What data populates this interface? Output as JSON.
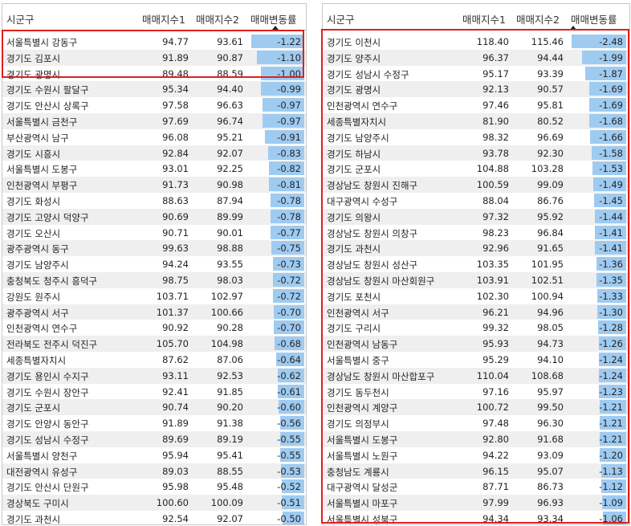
{
  "headers": {
    "name": "시군구",
    "idx1": "매매지수1",
    "idx2": "매매지수2",
    "chg": "매매변동률"
  },
  "colors": {
    "bar": "#9fcbf1",
    "highlight": "#e0201c",
    "alt_row": "#efefef"
  },
  "chart_data": [
    {
      "type": "table",
      "columns": [
        "시군구",
        "매매지수1",
        "매매지수2",
        "매매변동률"
      ],
      "sort": "매매변동률 ascending",
      "rows": [
        [
          "서울특별시 강동구",
          "94.77",
          "93.61",
          "-1.22"
        ],
        [
          "경기도 김포시",
          "91.89",
          "90.87",
          "-1.10"
        ],
        [
          "경기도 광명시",
          "89.48",
          "88.59",
          "-1.00"
        ],
        [
          "경기도 수원시 팔달구",
          "95.34",
          "94.40",
          "-0.99"
        ],
        [
          "경기도 안산시 상록구",
          "97.58",
          "96.63",
          "-0.97"
        ],
        [
          "서울특별시 금천구",
          "97.69",
          "96.74",
          "-0.97"
        ],
        [
          "부산광역시 남구",
          "96.08",
          "95.21",
          "-0.91"
        ],
        [
          "경기도 시흥시",
          "92.84",
          "92.07",
          "-0.83"
        ],
        [
          "서울특별시 도봉구",
          "93.01",
          "92.25",
          "-0.82"
        ],
        [
          "인천광역시 부평구",
          "91.73",
          "90.98",
          "-0.81"
        ],
        [
          "경기도 화성시",
          "88.63",
          "87.94",
          "-0.78"
        ],
        [
          "경기도 고양시 덕양구",
          "90.69",
          "89.99",
          "-0.78"
        ],
        [
          "경기도 오산시",
          "90.71",
          "90.01",
          "-0.77"
        ],
        [
          "광주광역시 동구",
          "99.63",
          "98.88",
          "-0.75"
        ],
        [
          "경기도 남양주시",
          "94.24",
          "93.55",
          "-0.73"
        ],
        [
          "충청북도 청주시 흥덕구",
          "98.75",
          "98.03",
          "-0.72"
        ],
        [
          "강원도 원주시",
          "103.71",
          "102.97",
          "-0.72"
        ],
        [
          "광주광역시 서구",
          "101.37",
          "100.66",
          "-0.70"
        ],
        [
          "인천광역시 연수구",
          "90.92",
          "90.28",
          "-0.70"
        ],
        [
          "전라북도 전주시 덕진구",
          "105.70",
          "104.98",
          "-0.68"
        ],
        [
          "세종특별자치시",
          "87.62",
          "87.06",
          "-0.64"
        ],
        [
          "경기도 용인시 수지구",
          "93.11",
          "92.53",
          "-0.62"
        ],
        [
          "경기도 수원시 장안구",
          "92.41",
          "91.85",
          "-0.61"
        ],
        [
          "경기도 군포시",
          "90.74",
          "90.20",
          "-0.60"
        ],
        [
          "경기도 안양시 동안구",
          "91.89",
          "91.38",
          "-0.56"
        ],
        [
          "경기도 성남시 수정구",
          "89.69",
          "89.19",
          "-0.55"
        ],
        [
          "서울특별시 양천구",
          "95.94",
          "95.41",
          "-0.55"
        ],
        [
          "대전광역시 유성구",
          "89.03",
          "88.55",
          "-0.53"
        ],
        [
          "경기도 안산시 단원구",
          "95.98",
          "95.48",
          "-0.52"
        ],
        [
          "경상북도 구미시",
          "100.60",
          "100.09",
          "-0.51"
        ],
        [
          "경기도 과천시",
          "92.54",
          "92.07",
          "-0.50"
        ]
      ]
    },
    {
      "type": "table",
      "columns": [
        "시군구",
        "매매지수1",
        "매매지수2",
        "매매변동률"
      ],
      "sort": "매매변동률 ascending",
      "rows": [
        [
          "경기도 이천시",
          "118.40",
          "115.46",
          "-2.48"
        ],
        [
          "경기도 양주시",
          "96.37",
          "94.44",
          "-1.99"
        ],
        [
          "경기도 성남시 수정구",
          "95.17",
          "93.39",
          "-1.87"
        ],
        [
          "경기도 광명시",
          "92.13",
          "90.57",
          "-1.69"
        ],
        [
          "인천광역시 연수구",
          "97.46",
          "95.81",
          "-1.69"
        ],
        [
          "세종특별자치시",
          "81.90",
          "80.52",
          "-1.68"
        ],
        [
          "경기도 남양주시",
          "98.32",
          "96.69",
          "-1.66"
        ],
        [
          "경기도 하남시",
          "93.78",
          "92.30",
          "-1.58"
        ],
        [
          "경기도 군포시",
          "104.88",
          "103.28",
          "-1.53"
        ],
        [
          "경상남도 창원시 진해구",
          "100.59",
          "99.09",
          "-1.49"
        ],
        [
          "대구광역시 수성구",
          "88.04",
          "86.76",
          "-1.45"
        ],
        [
          "경기도 의왕시",
          "97.32",
          "95.92",
          "-1.44"
        ],
        [
          "경상남도 창원시 의창구",
          "98.23",
          "96.84",
          "-1.41"
        ],
        [
          "경기도 과천시",
          "92.96",
          "91.65",
          "-1.41"
        ],
        [
          "경상남도 창원시 성산구",
          "103.35",
          "101.95",
          "-1.36"
        ],
        [
          "경상남도 창원시 마산회원구",
          "103.91",
          "102.51",
          "-1.35"
        ],
        [
          "경기도 포천시",
          "102.30",
          "100.94",
          "-1.33"
        ],
        [
          "인천광역시 서구",
          "96.21",
          "94.96",
          "-1.30"
        ],
        [
          "경기도 구리시",
          "99.32",
          "98.05",
          "-1.28"
        ],
        [
          "인천광역시 남동구",
          "95.93",
          "94.73",
          "-1.26"
        ],
        [
          "서울특별시 중구",
          "95.29",
          "94.10",
          "-1.24"
        ],
        [
          "경상남도 창원시 마산합포구",
          "110.04",
          "108.68",
          "-1.24"
        ],
        [
          "경기도 동두천시",
          "97.16",
          "95.97",
          "-1.23"
        ],
        [
          "인천광역시 계양구",
          "100.72",
          "99.50",
          "-1.21"
        ],
        [
          "경기도 의정부시",
          "97.48",
          "96.30",
          "-1.21"
        ],
        [
          "서울특별시 도봉구",
          "92.80",
          "91.68",
          "-1.21"
        ],
        [
          "서울특별시 노원구",
          "94.22",
          "93.09",
          "-1.20"
        ],
        [
          "충청남도 계룡시",
          "96.15",
          "95.07",
          "-1.13"
        ],
        [
          "대구광역시 달성군",
          "87.71",
          "86.73",
          "-1.12"
        ],
        [
          "서울특별시 마포구",
          "97.99",
          "96.93",
          "-1.09"
        ],
        [
          "서울특별시 성북구",
          "94.34",
          "93.34",
          "-1.06"
        ]
      ]
    }
  ]
}
